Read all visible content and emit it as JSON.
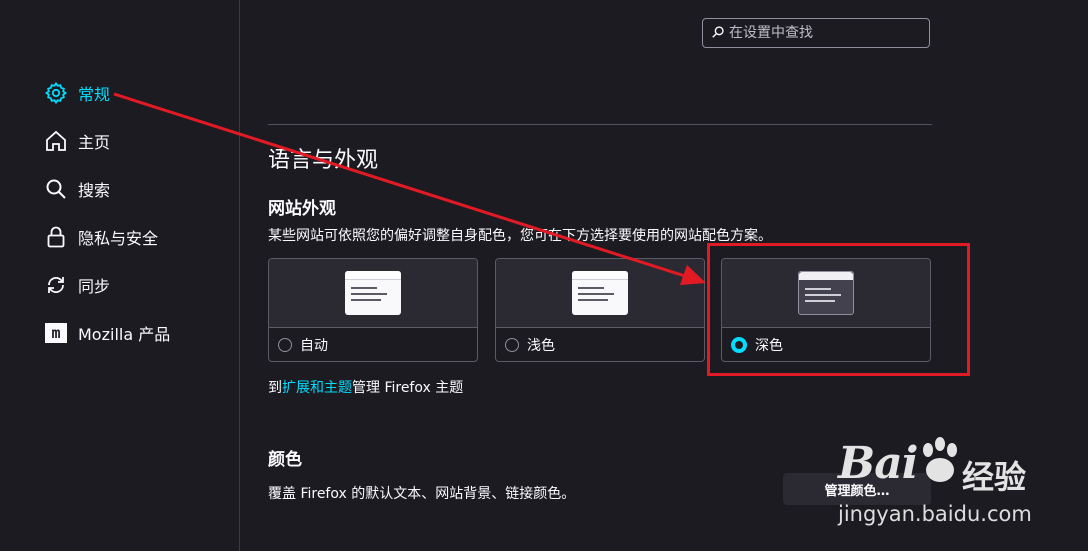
{
  "sidebar": {
    "items": [
      {
        "label": "常规",
        "icon": "gear-icon",
        "active": true
      },
      {
        "label": "主页",
        "icon": "home-icon"
      },
      {
        "label": "搜索",
        "icon": "search-icon"
      },
      {
        "label": "隐私与安全",
        "icon": "lock-icon"
      },
      {
        "label": "同步",
        "icon": "sync-icon"
      },
      {
        "label": "Mozilla 产品",
        "icon": "mozilla-icon"
      }
    ]
  },
  "search": {
    "placeholder": "在设置中查找"
  },
  "main": {
    "section_title": "语言与外观",
    "website_appearance": {
      "title": "网站外观",
      "description": "某些网站可依照您的偏好调整自身配色，您可在下方选择要使用的网站配色方案。",
      "options": [
        {
          "label": "自动",
          "selected": false
        },
        {
          "label": "浅色",
          "selected": false
        },
        {
          "label": "深色",
          "selected": true
        }
      ]
    },
    "manage_themes": {
      "prefix": "到",
      "link": "扩展和主题",
      "suffix": "管理 Firefox 主题"
    },
    "colors": {
      "title": "颜色",
      "description": "覆盖 Firefox 的默认文本、网站背景、链接颜色。",
      "button": "管理颜色…"
    }
  },
  "watermark": {
    "logo": "Bai",
    "name": "经验",
    "url": "jingyan.baidu.com"
  },
  "colors": {
    "accent": "#00ddff",
    "background": "#1c1b22",
    "annotation": "#e21a24"
  }
}
